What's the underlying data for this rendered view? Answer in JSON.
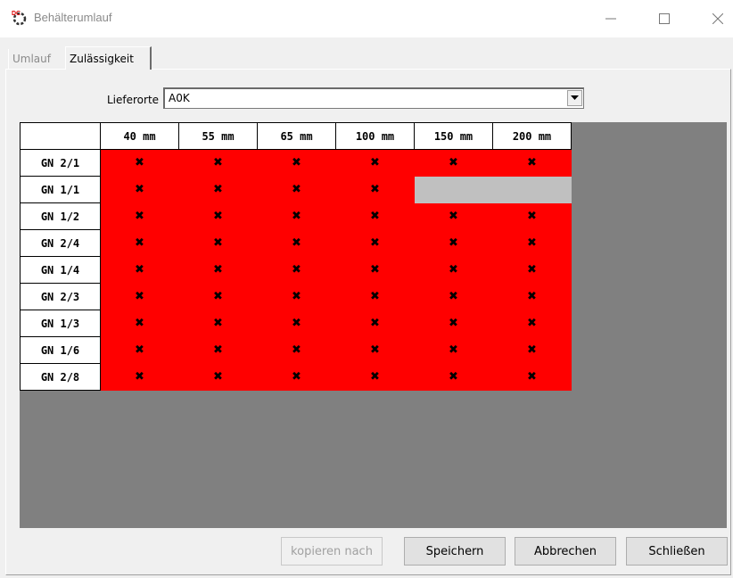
{
  "window": {
    "title": "Behälterumlauf"
  },
  "tabs": [
    {
      "label": "Umlauf",
      "active": false
    },
    {
      "label": "Zulässigkeit",
      "active": true
    }
  ],
  "lieferorte": {
    "label": "Lieferorte",
    "value": "A0K"
  },
  "grid": {
    "columns": [
      "40 mm",
      "55 mm",
      "65 mm",
      "100 mm",
      "150 mm",
      "200 mm"
    ],
    "rows": [
      {
        "label": "GN 2/1",
        "cells": [
          "x",
          "x",
          "x",
          "x",
          "x",
          "x"
        ]
      },
      {
        "label": "GN 1/1",
        "cells": [
          "x",
          "x",
          "x",
          "x",
          "",
          ""
        ]
      },
      {
        "label": "GN 1/2",
        "cells": [
          "x",
          "x",
          "x",
          "x",
          "x",
          "x"
        ]
      },
      {
        "label": "GN 2/4",
        "cells": [
          "x",
          "x",
          "x",
          "x",
          "x",
          "x"
        ]
      },
      {
        "label": "GN 1/4",
        "cells": [
          "x",
          "x",
          "x",
          "x",
          "x",
          "x"
        ]
      },
      {
        "label": "GN 2/3",
        "cells": [
          "x",
          "x",
          "x",
          "x",
          "x",
          "x"
        ]
      },
      {
        "label": "GN 1/3",
        "cells": [
          "x",
          "x",
          "x",
          "x",
          "x",
          "x"
        ]
      },
      {
        "label": "GN 1/6",
        "cells": [
          "x",
          "x",
          "x",
          "x",
          "x",
          "x"
        ]
      },
      {
        "label": "GN 2/8",
        "cells": [
          "x",
          "x",
          "x",
          "x",
          "x",
          "x"
        ]
      }
    ],
    "mark": "✖",
    "colors": {
      "allowed": "#ff0000",
      "empty": "#c0c0c0",
      "background": "#808080"
    }
  },
  "buttons": {
    "kopieren": "kopieren nach",
    "speichern": "Speichern",
    "abbrechen": "Abbrechen",
    "schliessen": "Schließen"
  }
}
